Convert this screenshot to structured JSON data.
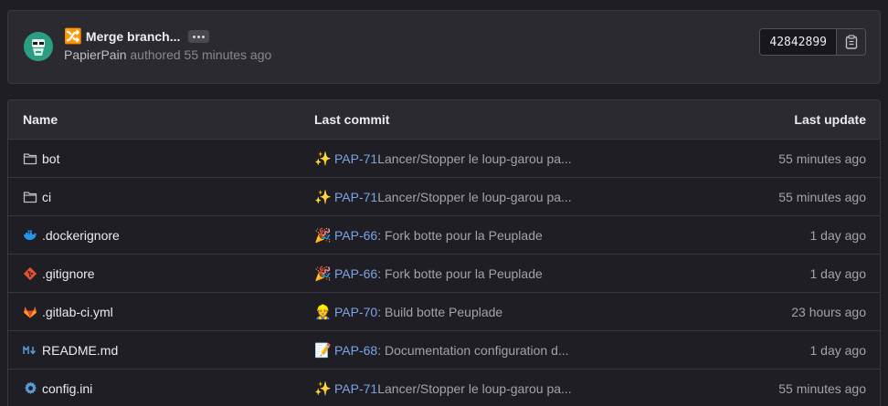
{
  "commit": {
    "emoji": "🔀",
    "title": "Merge branch...",
    "author": "PapierPain",
    "authored_text": "authored 55 minutes ago",
    "sha": "42842899"
  },
  "table": {
    "headers": {
      "name": "Name",
      "last_commit": "Last commit",
      "last_update": "Last update"
    },
    "rows": [
      {
        "name": "bot",
        "icon": "folder-icon",
        "commit_emoji": "✨",
        "issue": "PAP-71",
        "message": " Lancer/Stopper le loup-garou pa...",
        "date": "55 minutes ago"
      },
      {
        "name": "ci",
        "icon": "folder-icon",
        "commit_emoji": "✨",
        "issue": "PAP-71",
        "message": " Lancer/Stopper le loup-garou pa...",
        "date": "55 minutes ago"
      },
      {
        "name": ".dockerignore",
        "icon": "docker-icon",
        "commit_emoji": "🎉",
        "issue": "PAP-66",
        "message": " : Fork botte pour la Peuplade",
        "date": "1 day ago"
      },
      {
        "name": ".gitignore",
        "icon": "git-icon",
        "commit_emoji": "🎉",
        "issue": "PAP-66",
        "message": " : Fork botte pour la Peuplade",
        "date": "1 day ago"
      },
      {
        "name": ".gitlab-ci.yml",
        "icon": "gitlab-icon",
        "commit_emoji": "👷",
        "issue": "PAP-70",
        "message": " : Build botte Peuplade",
        "date": "23 hours ago"
      },
      {
        "name": "README.md",
        "icon": "markdown-icon",
        "commit_emoji": "📝",
        "issue": "PAP-68",
        "message": " : Documentation configuration d...",
        "date": "1 day ago"
      },
      {
        "name": "config.ini",
        "icon": "gear-icon",
        "commit_emoji": "✨",
        "issue": "PAP-71",
        "message": " Lancer/Stopper le loup-garou pa...",
        "date": "55 minutes ago"
      }
    ]
  }
}
